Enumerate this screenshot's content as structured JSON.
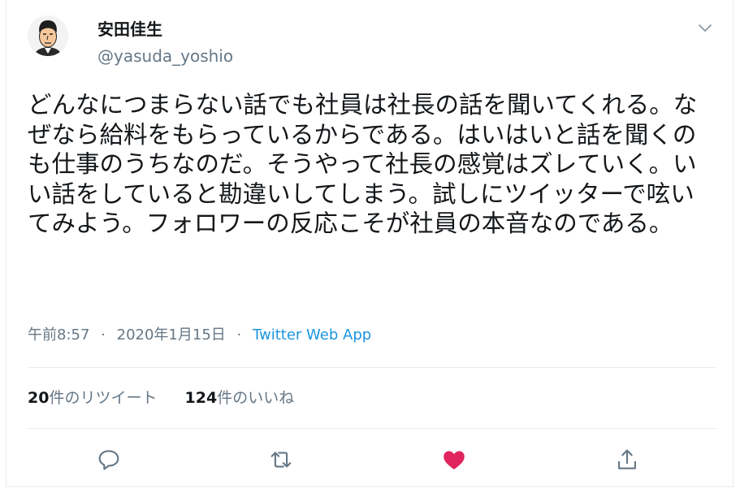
{
  "author": {
    "display_name": "安田佳生",
    "handle": "@yasuda_yoshio",
    "avatar_icon": "avatar-illustration-icon"
  },
  "tweet": {
    "text": "どんなにつまらない話でも社員は社長の話を聞いてくれる。なぜなら給料をもらっているからである。はいはいと話を聞くのも仕事のうちなのだ。そうやって社長の感覚はズレていく。いい話をしていると勘違いしてしまう。試しにツイッターで呟いてみよう。フォロワーの反応こそが社員の本音なのである。"
  },
  "meta": {
    "time": "午前8:57",
    "date": "2020年1月15日",
    "separator": "·",
    "source": "Twitter Web App"
  },
  "stats": {
    "retweets_count": "20",
    "retweets_label": "件のリツイート",
    "likes_count": "124",
    "likes_label": "件のいいね"
  },
  "actions": {
    "reply_icon": "reply-icon",
    "retweet_icon": "retweet-icon",
    "like_icon": "heart-icon",
    "share_icon": "share-icon"
  },
  "colors": {
    "text": "#14171a",
    "secondary": "#657786",
    "link": "#1b95e0",
    "like": "#e0245e",
    "border": "#e6ecf0"
  }
}
